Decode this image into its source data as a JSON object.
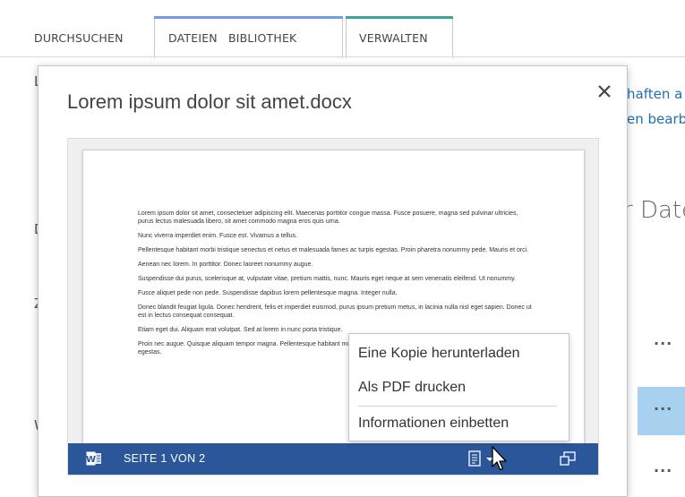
{
  "ribbon": {
    "tabs": [
      {
        "label": "DURCHSUCHEN"
      },
      {
        "label": "DATEIEN"
      },
      {
        "label": "BIBLIOTHEK"
      },
      {
        "label": "VERWALTEN"
      }
    ],
    "colors": {
      "files_group_accent": "#6e9ee6",
      "manage_group_accent": "#3aa5a0"
    }
  },
  "background": {
    "link_line_1": "haften a",
    "link_line_2": "en bearb",
    "heading_fragment": "r Date",
    "left_letters": [
      "L",
      "D",
      "Z",
      "W"
    ],
    "row_ellipsis": "...",
    "selected_row_color": "#a8d1f0"
  },
  "callout": {
    "title": "Lorem ipsum dolor sit amet.docx",
    "close_icon": "close-icon",
    "document_paragraphs": [
      "Lorem ipsum dolor sit amet, consectetuer adipiscing elit. Maecenas porttitor congue massa. Fusce posuere, magna sed pulvinar ultricies, purus lectus malesuada libero, sit amet commodo magna eros quis urna.",
      "Nunc viverra imperdiet enim. Fusce est. Vivamus a tellus.",
      "Pellentesque habitant morbi tristique senectus et netus et malesuada fames ac turpis egestas. Proin pharetra nonummy pede. Mauris et orci.",
      "Aenean nec lorem. In porttitor. Donec laoreet nonummy augue.",
      "Suspendisse dui purus, scelerisque at, vulputate vitae, pretium mattis, nunc. Mauris eget neque at sem venenatis eleifend. Ut nonummy.",
      "Fusce aliquet pede non pede. Suspendisse dapibus lorem pellentesque magna. Integer nulla.",
      "Donec blandit feugiat ligula. Donec hendrerit, felis et imperdiet euismod, purus ipsum pretium metus, in lacinia nulla nisl eget sapien. Donec ut est in lectus consequat consequat.",
      "Etiam eget dui. Aliquam erat volutpat. Sed at lorem in nunc porta tristique.",
      "Proin nec augue. Quisque aliquam tempor magna. Pellentesque habitant morbi tristique senectus et netus et malesuada fames ac turpis egestas."
    ],
    "viewer_bar": {
      "page_label": "SEITE 1 VON 2",
      "bar_color": "#2b579a",
      "icons": [
        "word-icon",
        "page-menu-icon",
        "chevron-down-icon",
        "popout-icon"
      ]
    },
    "menu": {
      "items": [
        {
          "label": "Eine Kopie herunterladen"
        },
        {
          "label": "Als PDF drucken"
        },
        {
          "label": "Informationen einbetten"
        }
      ]
    }
  }
}
